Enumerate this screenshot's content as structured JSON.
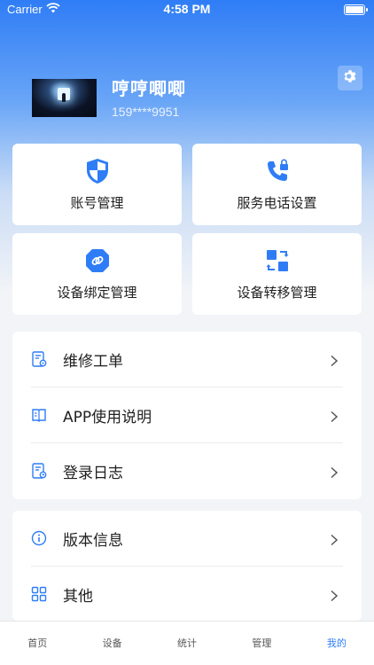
{
  "status_bar": {
    "carrier": "Carrier",
    "time": "4:58 PM"
  },
  "profile": {
    "name": "哼哼唧唧",
    "phone": "159****9951"
  },
  "quick_actions": [
    {
      "label": "账号管理",
      "icon": "shield-icon"
    },
    {
      "label": "服务电话设置",
      "icon": "phone-lock-icon"
    },
    {
      "label": "设备绑定管理",
      "icon": "link-icon"
    },
    {
      "label": "设备转移管理",
      "icon": "transfer-icon"
    }
  ],
  "menu_group_1": [
    {
      "label": "维修工单",
      "icon": "work-order-icon"
    },
    {
      "label": "APP使用说明",
      "icon": "manual-icon"
    },
    {
      "label": "登录日志",
      "icon": "log-icon"
    }
  ],
  "menu_group_2": [
    {
      "label": "版本信息",
      "icon": "info-icon"
    },
    {
      "label": "其他",
      "icon": "grid-icon"
    }
  ],
  "tabbar": {
    "items": [
      "首页",
      "设备",
      "统计",
      "管理",
      "我的"
    ],
    "active": "我的"
  },
  "colors": {
    "accent": "#2f7df6",
    "background": "#f2f4f7"
  }
}
